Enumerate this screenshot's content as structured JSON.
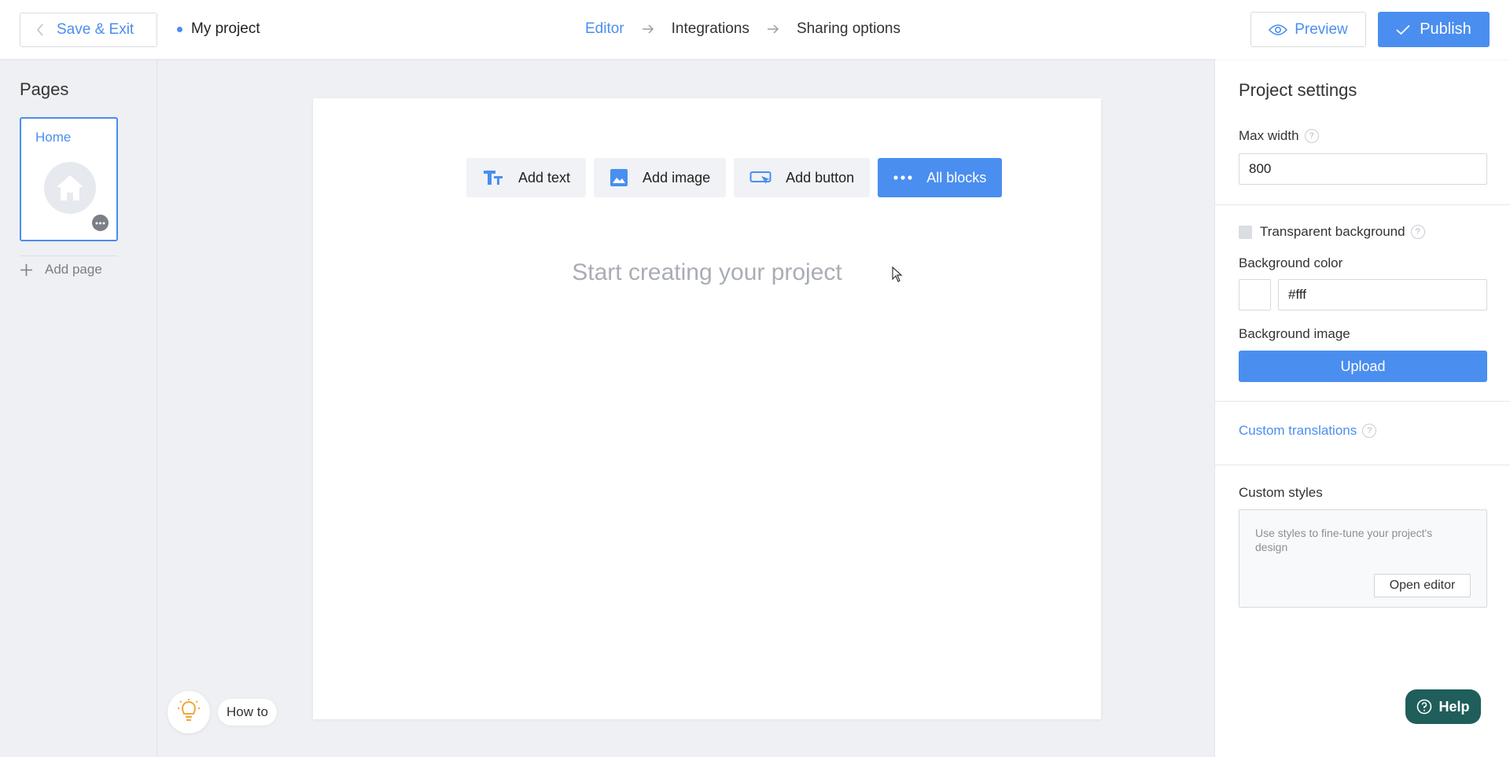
{
  "header": {
    "exit_label": "Save & Exit",
    "project_name": "My project",
    "steps": [
      "Editor",
      "Integrations",
      "Sharing options"
    ],
    "preview_label": "Preview",
    "publish_label": "Publish"
  },
  "sidebar": {
    "title": "Pages",
    "pages": [
      {
        "label": "Home"
      }
    ],
    "add_page_label": "Add page"
  },
  "canvas": {
    "toolbar": [
      {
        "label": "Add text",
        "icon": "text-icon"
      },
      {
        "label": "Add image",
        "icon": "image-icon"
      },
      {
        "label": "Add button",
        "icon": "button-icon"
      },
      {
        "label": "All blocks",
        "icon": "more-icon"
      }
    ],
    "placeholder": "Start creating your project"
  },
  "howto": {
    "label": "How to"
  },
  "settings": {
    "title": "Project settings",
    "max_width_label": "Max width",
    "max_width_value": "800",
    "transparent_label": "Transparent background",
    "bg_color_label": "Background color",
    "bg_color_value": "#fff",
    "bg_image_label": "Background image",
    "upload_label": "Upload",
    "translations_label": "Custom translations",
    "styles_label": "Custom styles",
    "styles_desc": "Use styles to fine-tune your project's design",
    "open_editor_label": "Open editor",
    "help_mark": "?"
  },
  "help": {
    "label": "Help"
  },
  "colors": {
    "accent": "#4a8ef0",
    "help_bg": "#1f5e5b",
    "page_bg": "#eef0f4"
  }
}
